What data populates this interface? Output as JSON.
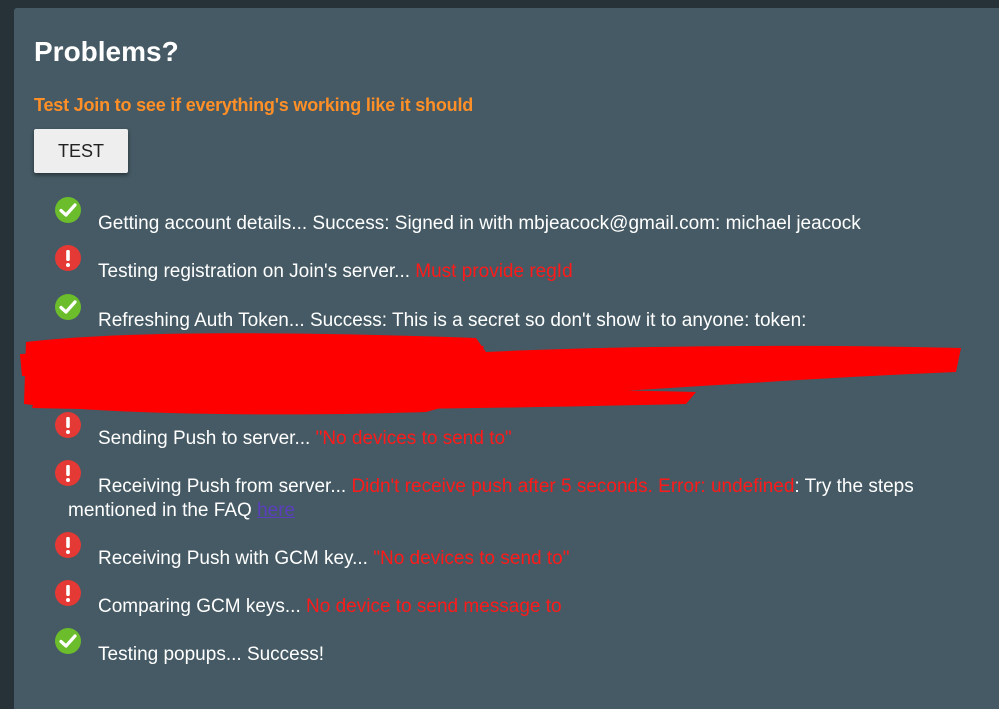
{
  "title": "Problems?",
  "subtitle": "Test Join to see if everything's working like it should",
  "test_button": "TEST",
  "steps": [
    {
      "status": "success",
      "label": "Getting account details...",
      "result": "Success: Signed in with mbjeacock@gmail.com: michael jeacock"
    },
    {
      "status": "error",
      "label": "Testing registration on Join's server...",
      "result": "Must provide regId"
    },
    {
      "status": "success",
      "label": "Refreshing Auth Token...",
      "result": "Success: This is a secret so don't show it to anyone: token:"
    },
    {
      "status": "error",
      "label": "Sending Push to server...",
      "result": "\"No devices to send to\""
    },
    {
      "status": "error",
      "label": "Receiving Push from server...",
      "result": "Didn't receive push after 5 seconds. Error: undefined",
      "extra": ": Try the steps",
      "extra2": "mentioned in the FAQ",
      "link": "here"
    },
    {
      "status": "error",
      "label": "Receiving Push with GCM key...",
      "result": "\"No devices to send to\""
    },
    {
      "status": "error",
      "label": "Comparing GCM keys...",
      "result": "No device to send message to"
    },
    {
      "status": "success",
      "label": "Testing popups...",
      "result": "Success!"
    }
  ],
  "colors": {
    "background": "#263238",
    "panel": "#455a64",
    "accent": "#ff8f26",
    "error": "#ff1a1a",
    "success": "#6bbd2b",
    "error_icon": "#e53935",
    "redaction": "#ff0000"
  }
}
